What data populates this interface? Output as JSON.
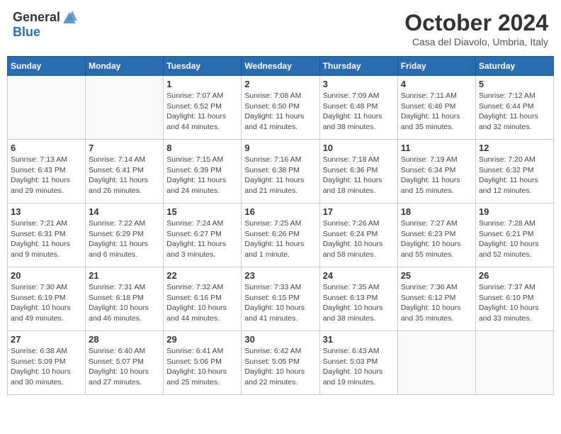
{
  "header": {
    "logo_general": "General",
    "logo_blue": "Blue",
    "month_title": "October 2024",
    "location": "Casa del Diavolo, Umbria, Italy"
  },
  "days_of_week": [
    "Sunday",
    "Monday",
    "Tuesday",
    "Wednesday",
    "Thursday",
    "Friday",
    "Saturday"
  ],
  "weeks": [
    [
      {
        "day": "",
        "info": ""
      },
      {
        "day": "",
        "info": ""
      },
      {
        "day": "1",
        "info": "Sunrise: 7:07 AM\nSunset: 6:52 PM\nDaylight: 11 hours and 44 minutes."
      },
      {
        "day": "2",
        "info": "Sunrise: 7:08 AM\nSunset: 6:50 PM\nDaylight: 11 hours and 41 minutes."
      },
      {
        "day": "3",
        "info": "Sunrise: 7:09 AM\nSunset: 6:48 PM\nDaylight: 11 hours and 38 minutes."
      },
      {
        "day": "4",
        "info": "Sunrise: 7:11 AM\nSunset: 6:46 PM\nDaylight: 11 hours and 35 minutes."
      },
      {
        "day": "5",
        "info": "Sunrise: 7:12 AM\nSunset: 6:44 PM\nDaylight: 11 hours and 32 minutes."
      }
    ],
    [
      {
        "day": "6",
        "info": "Sunrise: 7:13 AM\nSunset: 6:43 PM\nDaylight: 11 hours and 29 minutes."
      },
      {
        "day": "7",
        "info": "Sunrise: 7:14 AM\nSunset: 6:41 PM\nDaylight: 11 hours and 26 minutes."
      },
      {
        "day": "8",
        "info": "Sunrise: 7:15 AM\nSunset: 6:39 PM\nDaylight: 11 hours and 24 minutes."
      },
      {
        "day": "9",
        "info": "Sunrise: 7:16 AM\nSunset: 6:38 PM\nDaylight: 11 hours and 21 minutes."
      },
      {
        "day": "10",
        "info": "Sunrise: 7:18 AM\nSunset: 6:36 PM\nDaylight: 11 hours and 18 minutes."
      },
      {
        "day": "11",
        "info": "Sunrise: 7:19 AM\nSunset: 6:34 PM\nDaylight: 11 hours and 15 minutes."
      },
      {
        "day": "12",
        "info": "Sunrise: 7:20 AM\nSunset: 6:32 PM\nDaylight: 11 hours and 12 minutes."
      }
    ],
    [
      {
        "day": "13",
        "info": "Sunrise: 7:21 AM\nSunset: 6:31 PM\nDaylight: 11 hours and 9 minutes."
      },
      {
        "day": "14",
        "info": "Sunrise: 7:22 AM\nSunset: 6:29 PM\nDaylight: 11 hours and 6 minutes."
      },
      {
        "day": "15",
        "info": "Sunrise: 7:24 AM\nSunset: 6:27 PM\nDaylight: 11 hours and 3 minutes."
      },
      {
        "day": "16",
        "info": "Sunrise: 7:25 AM\nSunset: 6:26 PM\nDaylight: 11 hours and 1 minute."
      },
      {
        "day": "17",
        "info": "Sunrise: 7:26 AM\nSunset: 6:24 PM\nDaylight: 10 hours and 58 minutes."
      },
      {
        "day": "18",
        "info": "Sunrise: 7:27 AM\nSunset: 6:23 PM\nDaylight: 10 hours and 55 minutes."
      },
      {
        "day": "19",
        "info": "Sunrise: 7:28 AM\nSunset: 6:21 PM\nDaylight: 10 hours and 52 minutes."
      }
    ],
    [
      {
        "day": "20",
        "info": "Sunrise: 7:30 AM\nSunset: 6:19 PM\nDaylight: 10 hours and 49 minutes."
      },
      {
        "day": "21",
        "info": "Sunrise: 7:31 AM\nSunset: 6:18 PM\nDaylight: 10 hours and 46 minutes."
      },
      {
        "day": "22",
        "info": "Sunrise: 7:32 AM\nSunset: 6:16 PM\nDaylight: 10 hours and 44 minutes."
      },
      {
        "day": "23",
        "info": "Sunrise: 7:33 AM\nSunset: 6:15 PM\nDaylight: 10 hours and 41 minutes."
      },
      {
        "day": "24",
        "info": "Sunrise: 7:35 AM\nSunset: 6:13 PM\nDaylight: 10 hours and 38 minutes."
      },
      {
        "day": "25",
        "info": "Sunrise: 7:36 AM\nSunset: 6:12 PM\nDaylight: 10 hours and 35 minutes."
      },
      {
        "day": "26",
        "info": "Sunrise: 7:37 AM\nSunset: 6:10 PM\nDaylight: 10 hours and 33 minutes."
      }
    ],
    [
      {
        "day": "27",
        "info": "Sunrise: 6:38 AM\nSunset: 5:09 PM\nDaylight: 10 hours and 30 minutes."
      },
      {
        "day": "28",
        "info": "Sunrise: 6:40 AM\nSunset: 5:07 PM\nDaylight: 10 hours and 27 minutes."
      },
      {
        "day": "29",
        "info": "Sunrise: 6:41 AM\nSunset: 5:06 PM\nDaylight: 10 hours and 25 minutes."
      },
      {
        "day": "30",
        "info": "Sunrise: 6:42 AM\nSunset: 5:05 PM\nDaylight: 10 hours and 22 minutes."
      },
      {
        "day": "31",
        "info": "Sunrise: 6:43 AM\nSunset: 5:03 PM\nDaylight: 10 hours and 19 minutes."
      },
      {
        "day": "",
        "info": ""
      },
      {
        "day": "",
        "info": ""
      }
    ]
  ]
}
